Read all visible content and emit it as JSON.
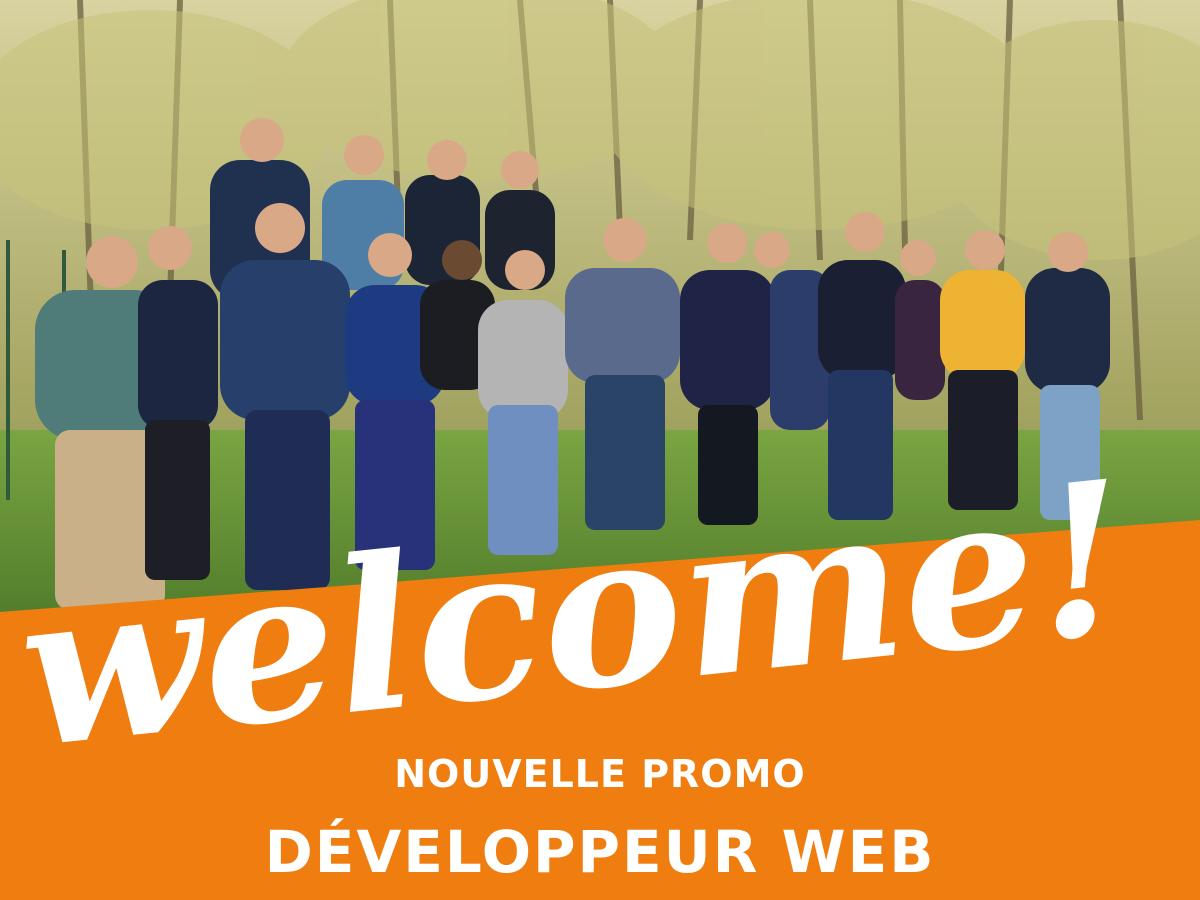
{
  "poster": {
    "welcome": "welcome!",
    "subtitle": "NOUVELLE PROMO",
    "title": "DÉVELOPPEUR WEB"
  },
  "colors": {
    "banner": "#ef7d10",
    "text": "#ffffff",
    "foliage": "#c9b96a",
    "grass": "#6e9a3a"
  },
  "photo": {
    "description_icon": "group-photo-icon"
  }
}
